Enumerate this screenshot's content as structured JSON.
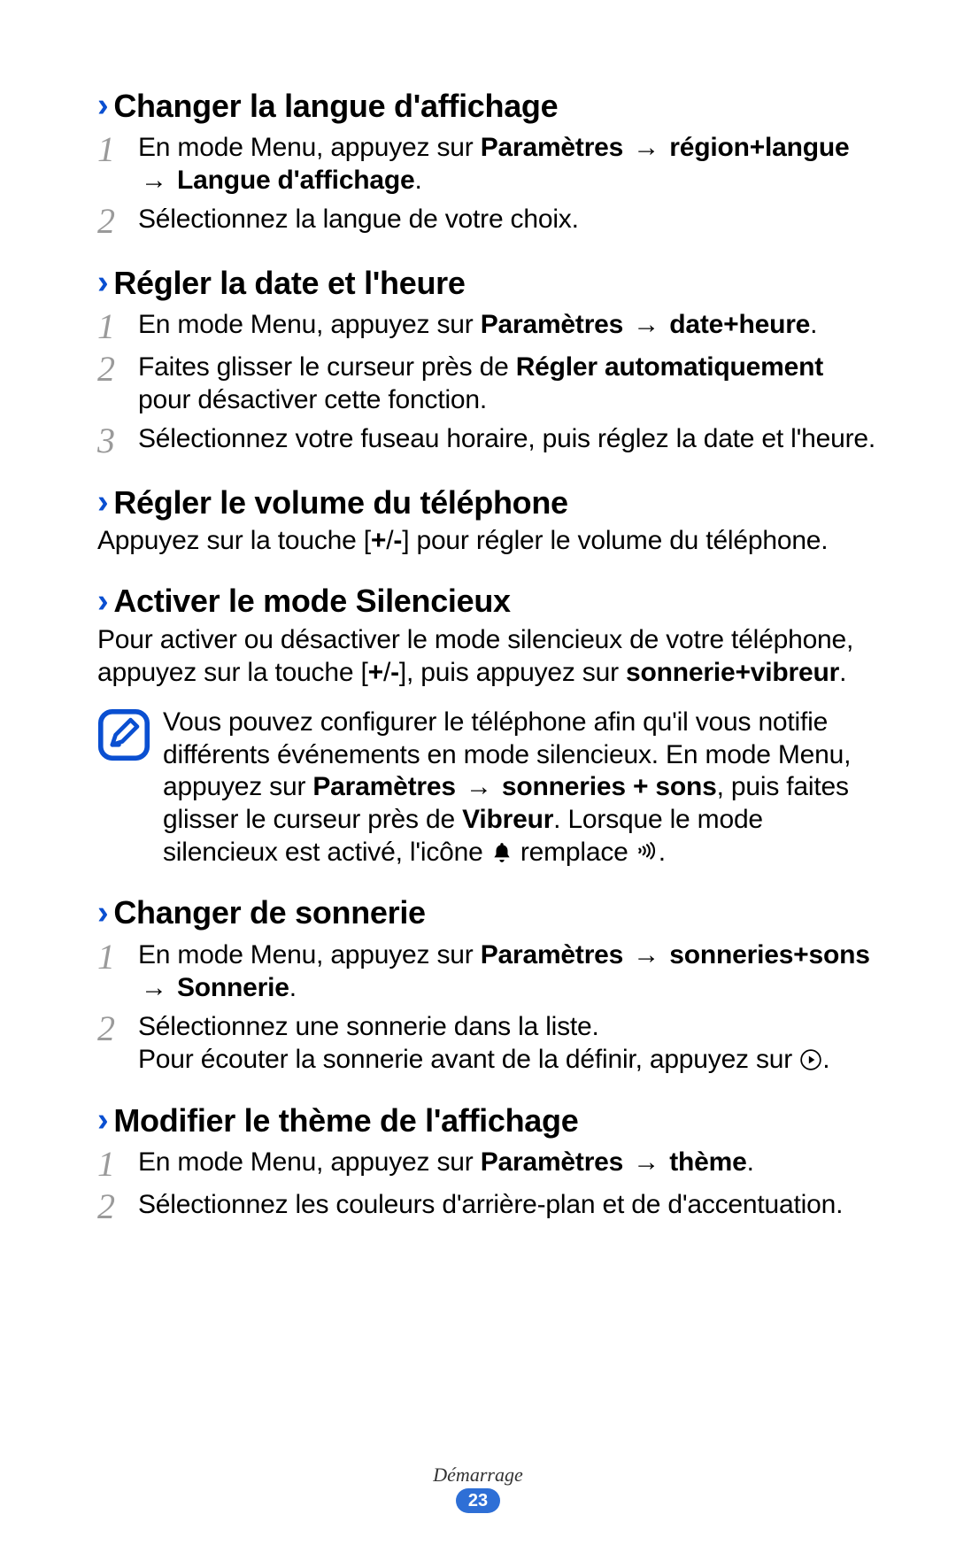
{
  "chevron": "›",
  "arrow": "→",
  "sections": [
    {
      "heading": "Changer la langue d'affichage",
      "steps": [
        {
          "num": "1",
          "html": "En mode Menu, appuyez sur <b>Paramètres</b> {arrow} <b>région+langue</b> {arrow} <b>Langue d'affichage</b>."
        },
        {
          "num": "2",
          "html": "Sélectionnez la langue de votre choix."
        }
      ]
    },
    {
      "heading": "Régler la date et l'heure",
      "steps": [
        {
          "num": "1",
          "html": "En mode Menu, appuyez sur <b>Paramètres</b> {arrow} <b>date+heure</b>."
        },
        {
          "num": "2",
          "html": "Faites glisser le curseur près de <b>Régler automatiquement</b> pour désactiver cette fonction."
        },
        {
          "num": "3",
          "html": "Sélectionnez votre fuseau horaire, puis réglez la date et l'heure."
        }
      ]
    },
    {
      "heading": "Régler le volume du téléphone",
      "para_html": "Appuyez sur la touche [<b>+</b>/<b>-</b>] pour régler le volume du téléphone."
    },
    {
      "heading": "Activer le mode Silencieux",
      "para_html": "Pour activer ou désactiver le mode silencieux de votre téléphone, appuyez sur la touche [<b>+</b>/<b>-</b>], puis appuyez sur <b>sonnerie+vibreur</b>.",
      "note_html": "Vous pouvez configurer le téléphone afin qu'il vous notifie différents événements en mode silencieux. En mode Menu, appuyez sur <b>Paramètres</b> {arrow} <b>sonneries + sons</b>, puis faites glisser le curseur près de <b>Vibreur</b>. Lorsque le mode silencieux est activé, l'icône {bell} remplace {vibrate}."
    },
    {
      "heading": "Changer de sonnerie",
      "steps": [
        {
          "num": "1",
          "html": "En mode Menu, appuyez sur <b>Paramètres</b> {arrow} <b>sonneries+sons</b> {arrow} <b>Sonnerie</b>."
        },
        {
          "num": "2",
          "html": "Sélectionnez une sonnerie dans la liste.<br>Pour écouter la sonnerie avant de la définir, appuyez sur {play}."
        }
      ]
    },
    {
      "heading": "Modifier le thème de l'affichage",
      "steps": [
        {
          "num": "1",
          "html": "En mode Menu, appuyez sur <b>Paramètres</b> {arrow} <b>thème</b>."
        },
        {
          "num": "2",
          "html": "Sélectionnez les couleurs d'arrière-plan et de d'accentuation."
        }
      ]
    }
  ],
  "footer": {
    "label": "Démarrage",
    "page": "23"
  }
}
